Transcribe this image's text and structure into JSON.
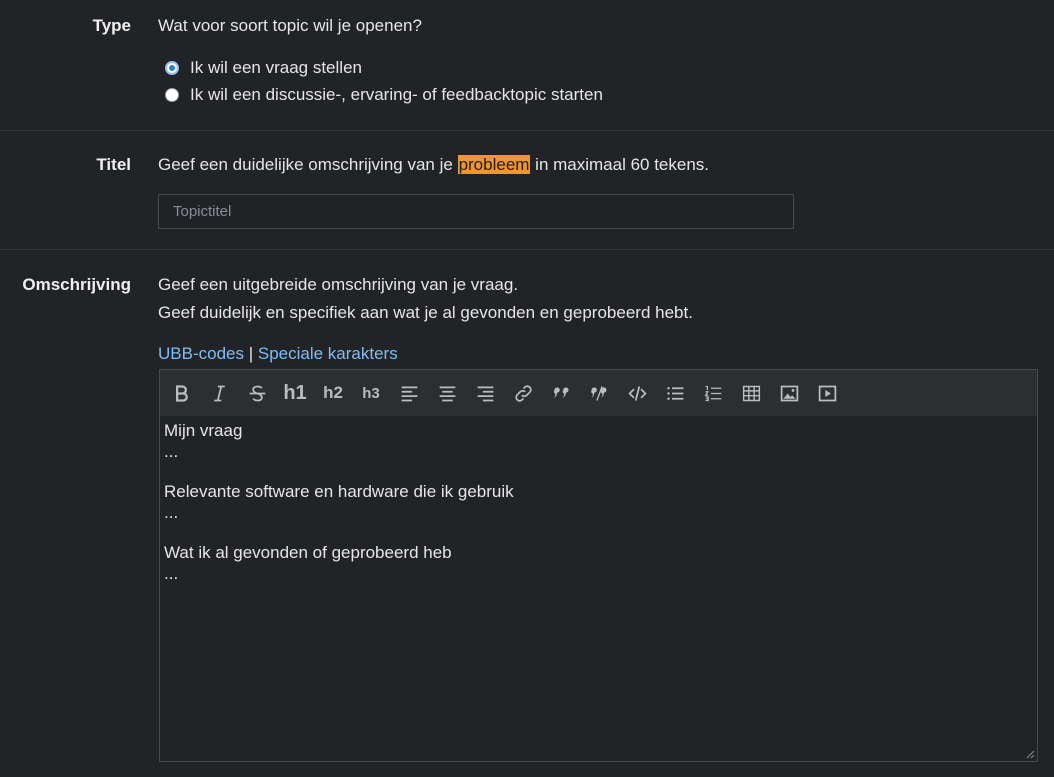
{
  "type_section": {
    "label": "Type",
    "question": "Wat voor soort topic wil je openen?",
    "options": [
      {
        "label": "Ik wil een vraag stellen",
        "checked": true
      },
      {
        "label": "Ik wil een discussie-, ervaring- of feedbacktopic starten",
        "checked": false
      }
    ]
  },
  "title_section": {
    "label": "Titel",
    "hint_before": "Geef een duidelijke omschrijving van je ",
    "hint_highlight": "probleem",
    "hint_after": " in maximaal 60 tekens.",
    "placeholder": "Topictitel"
  },
  "description_section": {
    "label": "Omschrijving",
    "hint_line1": "Geef een uitgebreide omschrijving van je vraag.",
    "hint_line2": "Geef duidelijk en specifiek aan wat je al gevonden en geprobeerd hebt.",
    "link_ubb": "UBB-codes",
    "link_separator": "|",
    "link_special": "Speciale karakters",
    "toolbar": [
      "bold-icon",
      "italic-icon",
      "strikethrough-icon",
      "h1",
      "h2",
      "h3",
      "align-left-icon",
      "align-center-icon",
      "align-right-icon",
      "link-icon",
      "quote-icon",
      "unquote-icon",
      "code-icon",
      "bullet-list-icon",
      "numbered-list-icon",
      "table-icon",
      "image-icon",
      "video-icon"
    ],
    "toolbar_labels": {
      "h1": "h1",
      "h2": "h2",
      "h3": "h3"
    },
    "editor_lines": [
      "Mijn vraag",
      "...",
      "",
      "Relevante software en hardware die ik gebruik",
      "...",
      "",
      "Wat ik al gevonden of geprobeerd heb",
      "..."
    ]
  },
  "colors": {
    "background": "#212327",
    "link": "#7dbef7",
    "highlight": "#f0962e"
  }
}
